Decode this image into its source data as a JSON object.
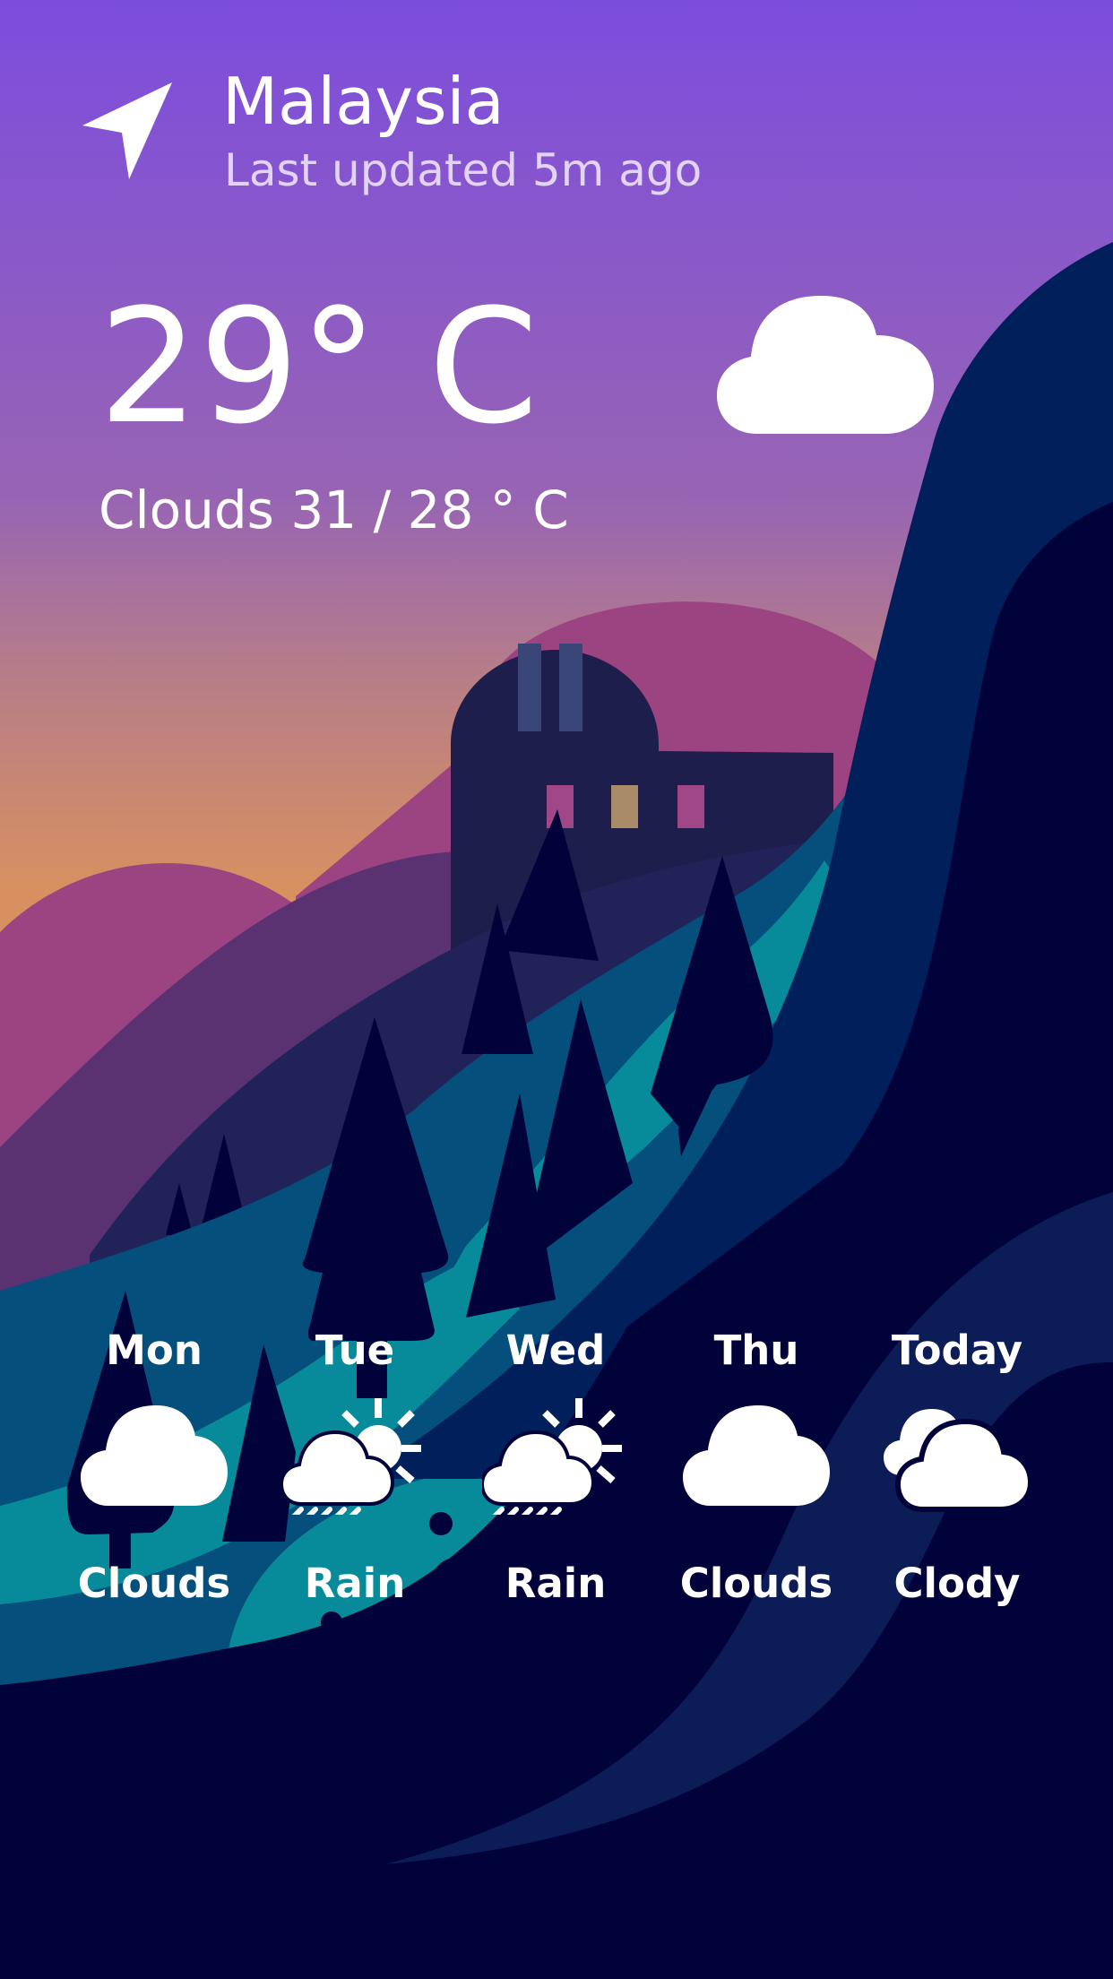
{
  "header": {
    "location": "Malaysia",
    "last_updated": "Last updated 5m ago",
    "icon": "navigation-arrow-icon"
  },
  "current": {
    "temperature": "29° C",
    "summary": "Clouds 31 / 28 ° C",
    "icon": "cloud-icon"
  },
  "forecast": [
    {
      "day": "Mon",
      "desc": "Clouds",
      "icon": "cloud-icon"
    },
    {
      "day": "Tue",
      "desc": "Rain",
      "icon": "rain-sun-icon"
    },
    {
      "day": "Wed",
      "desc": "Rain",
      "icon": "rain-sun-icon"
    },
    {
      "day": "Thu",
      "desc": "Clouds",
      "icon": "cloud-icon"
    },
    {
      "day": "Today",
      "desc": "Clody",
      "icon": "cloudy-icon"
    }
  ],
  "colors": {
    "sky_top": "#7c4ddd",
    "sky_bottom": "#d99060",
    "night": "#02023a",
    "teal": "#078b9a",
    "text": "#ffffff"
  }
}
